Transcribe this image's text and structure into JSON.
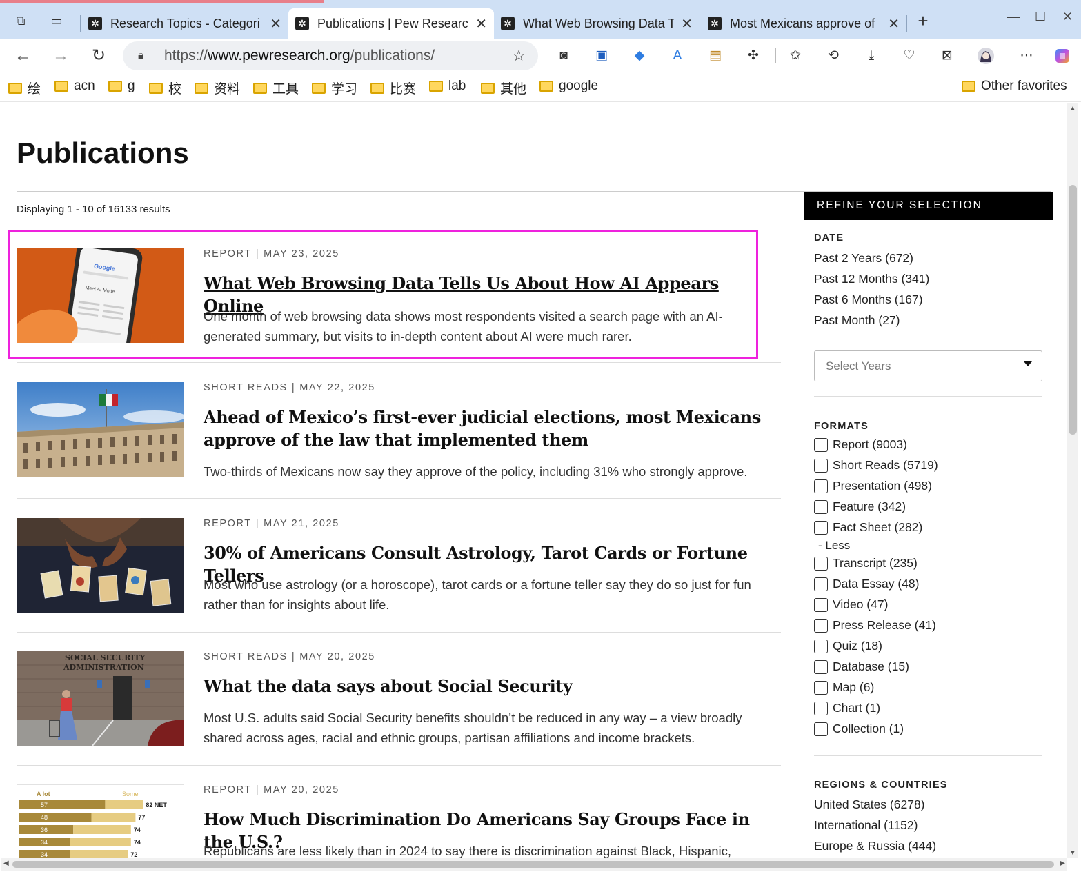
{
  "browser": {
    "tabs": [
      {
        "label": "Research Topics - Categori",
        "active": false
      },
      {
        "label": "Publications | Pew Researc",
        "active": true
      },
      {
        "label": "What Web Browsing Data T",
        "active": false
      },
      {
        "label": "Most Mexicans approve of",
        "active": false
      }
    ],
    "new_tab_glyph": "+",
    "close_glyph": "✕",
    "url_prefix": "https://",
    "url_host": "www.pewresearch.org",
    "url_path": "/publications/",
    "bookmarks": [
      "绘",
      "acn",
      "g",
      "校",
      "资料",
      "工具",
      "学习",
      "比赛",
      "lab",
      "其他",
      "google"
    ],
    "other_favorites": "Other favorites",
    "colors": {
      "tab_strip": "#cfe0f5",
      "highlight": "#ee22dd"
    }
  },
  "page": {
    "title": "Publications",
    "results_count": "Displaying 1 - 10 of 16133 results",
    "publications": [
      {
        "type": "REPORT",
        "date": "MAY 23, 2025",
        "title": "What Web Browsing Data Tells Us About How AI Appears Online",
        "description": "One month of web browsing data shows most respondents visited a search page with an AI-generated summary, but visits to in-depth content about AI were much rarer.",
        "image": "phone-google-ai-mode",
        "image_text": {
          "brand": "Google",
          "caption": "Meet AI Mode"
        }
      },
      {
        "type": "SHORT READS",
        "date": "MAY 22, 2025",
        "title": "Ahead of Mexico’s first-ever judicial elections, most Mexicans approve of the law that implemented them",
        "description": "Two-thirds of Mexicans now say they approve of the policy, including 31% who strongly approve.",
        "image": "mexico-court-building-flag"
      },
      {
        "type": "REPORT",
        "date": "MAY 21, 2025",
        "title": "30% of Americans Consult Astrology, Tarot Cards or Fortune Tellers",
        "description": "Most who use astrology (or a horoscope), tarot cards or a fortune teller say they do so just for fun rather than for insights about life.",
        "image": "tarot-cards-table"
      },
      {
        "type": "SHORT READS",
        "date": "MAY 20, 2025",
        "title": "What the data says about Social Security",
        "description": "Most U.S. adults said Social Security benefits shouldn’t be reduced in any way – a view broadly shared across ages, racial and ethnic groups, partisan affiliations and income brackets.",
        "image": "social-security-office",
        "image_text": {
          "sign_line1": "SOCIAL SECURITY",
          "sign_line2": "ADMINISTRATION"
        }
      },
      {
        "type": "REPORT",
        "date": "MAY 20, 2025",
        "title": "How Much Discrimination Do Americans Say Groups Face in the U.S.?",
        "description": "Republicans are less likely than in 2024 to say there is discrimination against Black, Hispanic,",
        "image": "discrimination-bar-chart-thumb"
      }
    ]
  },
  "chart_data": {
    "type": "bar",
    "series": [
      {
        "name": "A lot",
        "values": [
          57,
          48,
          36,
          34,
          34
        ]
      },
      {
        "name": "Some",
        "values": [
          25,
          29,
          38,
          40,
          38
        ]
      }
    ],
    "net_labels": [
      "82 NET",
      "77",
      "74",
      "74",
      "72"
    ],
    "legend": [
      "A lot",
      "Some"
    ],
    "colors": {
      "a_lot": "#a8893a",
      "some": "#e6cc82"
    }
  },
  "sidebar": {
    "header": "REFINE YOUR SELECTION",
    "date": {
      "heading": "DATE",
      "options": [
        "Past 2 Years (672)",
        "Past 12 Months (341)",
        "Past 6 Months (167)",
        "Past Month (27)"
      ],
      "select_placeholder": "Select Years"
    },
    "formats": {
      "heading": "FORMATS",
      "options": [
        "Report (9003)",
        "Short Reads (5719)",
        "Presentation (498)",
        "Feature (342)",
        "Fact Sheet (282)",
        "Transcript (235)",
        "Data Essay (48)",
        "Video (47)",
        "Press Release (41)",
        "Quiz (18)",
        "Database (15)",
        "Map (6)",
        "Chart (1)",
        "Collection (1)"
      ],
      "less_label": "- Less"
    },
    "regions": {
      "heading": "REGIONS & COUNTRIES",
      "options": [
        "United States (6278)",
        "International (1152)",
        "Europe & Russia (444)"
      ]
    }
  }
}
